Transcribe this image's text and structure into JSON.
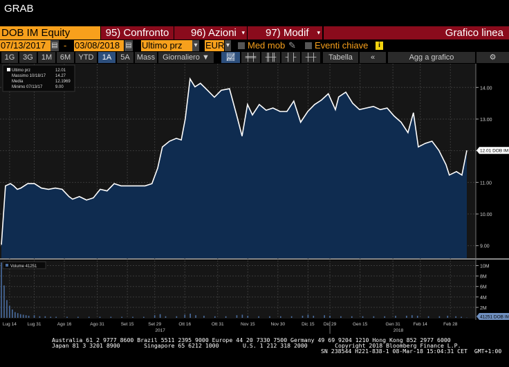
{
  "window": {
    "title": "GRAB"
  },
  "header": {
    "ticker": "DOB IM Equity",
    "compare": "95) Confronto",
    "actions": "96) Azioni",
    "modify": "97) Modif",
    "chart_type": "Grafico linea"
  },
  "controls": {
    "start_date": "07/13/2017",
    "dash": "-",
    "end_date": "03/08/2018",
    "field": "Ultimo prz",
    "currency": "EUR",
    "moving_avg": "Med mob",
    "key_events": "Eventi chiave",
    "info": "i"
  },
  "toolbar": {
    "periods": [
      "1G",
      "3G",
      "1M",
      "6M",
      "YTD",
      "1A",
      "5A",
      "Mass"
    ],
    "active_period": "1A",
    "frequency": "Giornaliero ▼",
    "table": "Tabella",
    "collapse": "«",
    "add_to_chart": "Agg a grafico",
    "settings": "⚙"
  },
  "legend": {
    "rows": [
      {
        "label": "Ultimo prz",
        "value": "12.01"
      },
      {
        "label": "Massimo 10/18/17",
        "value": "14.27"
      },
      {
        "label": "Media",
        "value": "12.1969"
      },
      {
        "label": "Minimo 07/13/17",
        "value": "9.00"
      }
    ],
    "volume_label": "Volume 41251"
  },
  "chart_data": {
    "type": "area",
    "x_unit": "trading day index",
    "xlim": [
      0,
      170
    ],
    "ylim": [
      8.6,
      14.75
    ],
    "yticks": [
      9,
      10,
      11,
      12,
      13,
      14
    ],
    "ytick_labels": [
      "9.00",
      "10.00",
      "11.00",
      "12.00",
      "13.00",
      "14.00"
    ],
    "last_label": "12.01 DOB IM",
    "price": [
      [
        0,
        9.03
      ],
      [
        1.5,
        10.89
      ],
      [
        3.3,
        10.96
      ],
      [
        4.5,
        10.89
      ],
      [
        5.8,
        10.78
      ],
      [
        7.1,
        10.82
      ],
      [
        9.6,
        10.96
      ],
      [
        12.1,
        10.96
      ],
      [
        14.6,
        10.82
      ],
      [
        17.2,
        10.78
      ],
      [
        19.7,
        10.82
      ],
      [
        22.2,
        10.78
      ],
      [
        24.7,
        10.55
      ],
      [
        26,
        10.47
      ],
      [
        28.5,
        10.55
      ],
      [
        31.1,
        10.44
      ],
      [
        33.6,
        10.51
      ],
      [
        36.1,
        10.78
      ],
      [
        38.6,
        10.73
      ],
      [
        41.2,
        10.96
      ],
      [
        43.7,
        10.89
      ],
      [
        46.2,
        10.89
      ],
      [
        48.7,
        10.89
      ],
      [
        52.5,
        10.89
      ],
      [
        55,
        10.96
      ],
      [
        57.1,
        11.45
      ],
      [
        58.8,
        12.12
      ],
      [
        61.4,
        12.3
      ],
      [
        63.9,
        12.39
      ],
      [
        65.7,
        12.34
      ],
      [
        67.2,
        13.02
      ],
      [
        68.9,
        14.27
      ],
      [
        70.7,
        14.02
      ],
      [
        72.7,
        14.13
      ],
      [
        75.3,
        13.91
      ],
      [
        77.8,
        13.69
      ],
      [
        80.3,
        13.91
      ],
      [
        83.3,
        13.96
      ],
      [
        85.9,
        13.13
      ],
      [
        87.9,
        12.46
      ],
      [
        89.9,
        13.46
      ],
      [
        91.7,
        13.13
      ],
      [
        94.2,
        13.46
      ],
      [
        96.7,
        13.28
      ],
      [
        99.2,
        13.35
      ],
      [
        101.8,
        13.24
      ],
      [
        104.3,
        13.24
      ],
      [
        106.8,
        13.57
      ],
      [
        109.3,
        12.9
      ],
      [
        111.9,
        13.24
      ],
      [
        114.4,
        13.46
      ],
      [
        116.9,
        13.6
      ],
      [
        119.4,
        13.8
      ],
      [
        122,
        13.3
      ],
      [
        123.2,
        13.7
      ],
      [
        125.8,
        13.85
      ],
      [
        128.3,
        13.5
      ],
      [
        130.8,
        13.3
      ],
      [
        133.3,
        13.35
      ],
      [
        135.9,
        13.4
      ],
      [
        138.4,
        13.3
      ],
      [
        140.9,
        13.35
      ],
      [
        143.4,
        13.1
      ],
      [
        146,
        12.9
      ],
      [
        148.5,
        12.57
      ],
      [
        150.5,
        13.2
      ],
      [
        152.3,
        12.12
      ],
      [
        154.8,
        12.23
      ],
      [
        157.3,
        12.3
      ],
      [
        159.8,
        12.01
      ],
      [
        162.4,
        11.56
      ],
      [
        163.6,
        11.23
      ],
      [
        166.2,
        11.34
      ],
      [
        168.2,
        11.23
      ],
      [
        170,
        12.01
      ]
    ],
    "volume_ylim": [
      0,
      11
    ],
    "volume_yticks": [
      2,
      4,
      6,
      8,
      10
    ],
    "volume_ytick_labels": [
      "2M",
      "4M",
      "6M",
      "8M",
      "10M"
    ],
    "volume_last_label": "41251 DOB IM",
    "volume_millions": [
      [
        0,
        10.6
      ],
      [
        1,
        6.2
      ],
      [
        2,
        3.4
      ],
      [
        3,
        2.3
      ],
      [
        4,
        1.6
      ],
      [
        5,
        1.1
      ],
      [
        6,
        0.9
      ],
      [
        7,
        0.7
      ],
      [
        8,
        0.6
      ],
      [
        9,
        0.5
      ],
      [
        10,
        0.4
      ],
      [
        12,
        0.5
      ],
      [
        14,
        0.3
      ],
      [
        16,
        0.3
      ],
      [
        18,
        0.2
      ],
      [
        20,
        0.2
      ],
      [
        24,
        0.2
      ],
      [
        28,
        0.2
      ],
      [
        32,
        0.2
      ],
      [
        36,
        0.2
      ],
      [
        40,
        0.2
      ],
      [
        44,
        0.2
      ],
      [
        48,
        0.2
      ],
      [
        52,
        0.2
      ],
      [
        56,
        0.5
      ],
      [
        58,
        0.7
      ],
      [
        60,
        0.3
      ],
      [
        64,
        0.3
      ],
      [
        67,
        0.6
      ],
      [
        69,
        0.8
      ],
      [
        71,
        0.5
      ],
      [
        74,
        0.4
      ],
      [
        78,
        0.3
      ],
      [
        82,
        0.3
      ],
      [
        86,
        0.5
      ],
      [
        88,
        0.6
      ],
      [
        90,
        0.4
      ],
      [
        94,
        0.3
      ],
      [
        98,
        0.3
      ],
      [
        102,
        0.3
      ],
      [
        106,
        0.3
      ],
      [
        110,
        0.4
      ],
      [
        112,
        0.6
      ],
      [
        114,
        0.4
      ],
      [
        118,
        0.5
      ],
      [
        120,
        0.4
      ],
      [
        124,
        0.3
      ],
      [
        128,
        0.3
      ],
      [
        132,
        0.3
      ],
      [
        136,
        0.3
      ],
      [
        140,
        0.3
      ],
      [
        144,
        0.4
      ],
      [
        148,
        0.4
      ],
      [
        150,
        0.5
      ],
      [
        152,
        0.4
      ],
      [
        156,
        0.3
      ],
      [
        160,
        0.3
      ],
      [
        163,
        0.4
      ],
      [
        166,
        0.3
      ],
      [
        168,
        0.2
      ],
      [
        170,
        0.04
      ]
    ],
    "xticks": [
      [
        3,
        "Lug 14"
      ],
      [
        12,
        "Lug 31"
      ],
      [
        23,
        "Ago 16"
      ],
      [
        35,
        "Ago 31"
      ],
      [
        46,
        "Set 15"
      ],
      [
        56,
        "Set 29"
      ],
      [
        67,
        "Ott 16"
      ],
      [
        79,
        "Ott 31"
      ],
      [
        90,
        "Nov 15"
      ],
      [
        101,
        "Nov 30"
      ],
      [
        112,
        "Dic 15"
      ],
      [
        120,
        "Dic 29"
      ],
      [
        131,
        "Gen 15"
      ],
      [
        143,
        "Gen 31"
      ],
      [
        153,
        "Feb 14"
      ],
      [
        164,
        "Feb 28"
      ]
    ],
    "years": [
      [
        58,
        "2017"
      ],
      [
        145,
        "2018"
      ]
    ],
    "year_divider": 120
  },
  "footer": {
    "line1": "Australia 61 2 9777 8600 Brazil 5511 2395 9000 Europe 44 20 7330 7500 Germany 49 69 9204 1210 Hong Kong 852 2977 6000",
    "line2": "Japan 81 3 3201 8900       Singapore 65 6212 1000       U.S. 1 212 318 2000        Copyright 2018 Bloomberg Finance L.P.",
    "line3": "SN 238544 H221-838-1 08-Mar-18 15:04:31 CET  GMT+1:00"
  },
  "colors": {
    "orange": "#f7a01c",
    "red": "#8a0b1c",
    "area": "#0f2c50",
    "line": "#ffffff"
  }
}
